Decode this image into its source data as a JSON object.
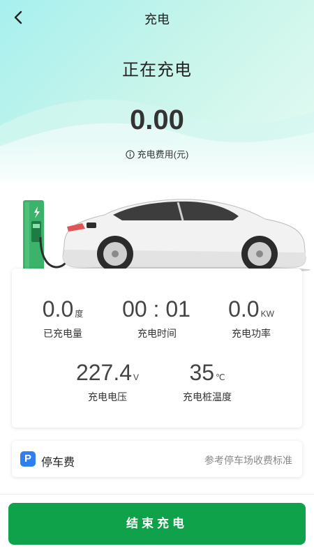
{
  "nav": {
    "title": "充电"
  },
  "status": "正在充电",
  "fee": {
    "amount": "0.00",
    "label": "充电费用(元)"
  },
  "stats": [
    {
      "value": "0.0",
      "unit": "度",
      "label": "已充电量"
    },
    {
      "value": "00 : 01",
      "unit": "",
      "label": "充电时间"
    },
    {
      "value": "0.0",
      "unit": "KW",
      "label": "充电功率"
    },
    {
      "value": "227.4",
      "unit": "V",
      "label": "充电电压"
    },
    {
      "value": "35",
      "unit": "℃",
      "label": "充电桩温度"
    }
  ],
  "parking": {
    "icon": "P",
    "label": "停车费",
    "note": "参考停车场收费标准"
  },
  "end_button": {
    "label": "结束充电"
  },
  "colors": {
    "primary_green": "#0fa24b",
    "parking_blue": "#2f7ff0",
    "charger_green": "#3bb36a"
  }
}
